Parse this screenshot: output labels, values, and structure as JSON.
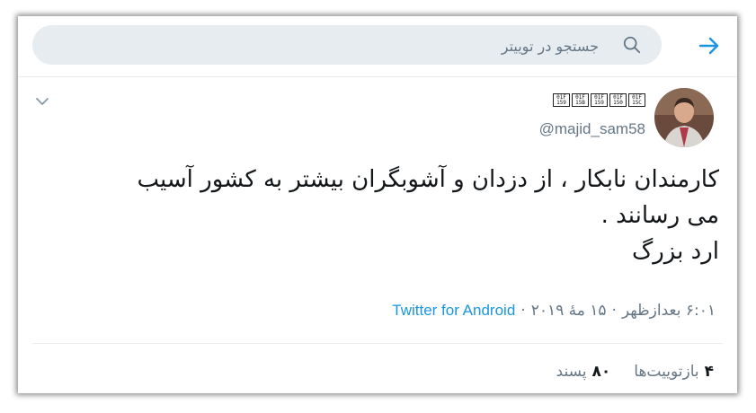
{
  "header": {
    "search_placeholder": "جستجو در توییتر",
    "back_icon": "arrow-right-icon",
    "search_icon": "search-icon"
  },
  "tweet": {
    "display_name_glyphs": [
      "01F 15C",
      "01F 150",
      "01F 159",
      "01F 15B",
      "01F 159"
    ],
    "username": "@majid_sam58",
    "text_lines": [
      "کارمندان نابکار ، از دزدان و آشوبگران بیشتر به کشور آسیب",
      "می رسانند .",
      " ارد بزرگ"
    ],
    "time": "۶:۰۱ بعدازظهر",
    "date": "۱۵ مهٔ ۲۰۱۹",
    "separator": "·",
    "source": "Twitter for Android",
    "retweets_count": "۴",
    "retweets_label": "بازتوییت‌ها",
    "likes_count": "۸۰",
    "likes_label": "پسند"
  },
  "colors": {
    "accent": "#1b95e0",
    "muted": "#657786",
    "text": "#14171a",
    "search_bg": "#e6ecf0"
  }
}
